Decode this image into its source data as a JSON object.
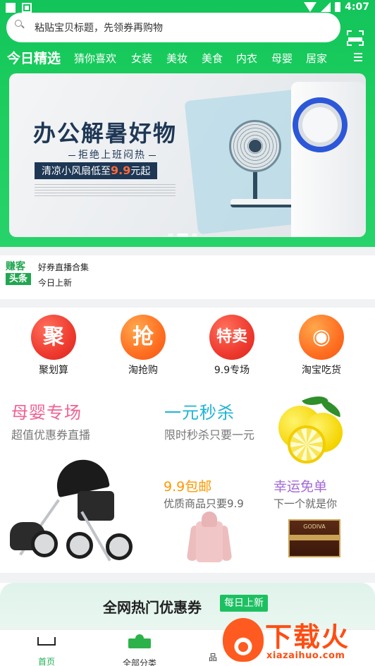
{
  "status_bar": {
    "time": "4:07"
  },
  "search": {
    "placeholder": "粘贴宝贝标题，先领券再购物",
    "scan_icon": "scan-icon"
  },
  "categories": [
    {
      "label": "今日精选",
      "active": true
    },
    {
      "label": "猜你喜欢"
    },
    {
      "label": "女装"
    },
    {
      "label": "美妆"
    },
    {
      "label": "美食"
    },
    {
      "label": "内衣"
    },
    {
      "label": "母婴"
    },
    {
      "label": "居家"
    }
  ],
  "banner": {
    "title": "办公解暑好物",
    "subtitle": "拒绝上班闷热",
    "tag_prefix": "清凉小风扇低至",
    "tag_price": "9.9",
    "tag_suffix": "元起",
    "slides": 3,
    "active_slide": 1
  },
  "news": {
    "logo_line1": "赚客",
    "logo_line2": "头条",
    "headline": "好券直播合集",
    "subline": "今日上新"
  },
  "quick_links": [
    {
      "label": "聚划算",
      "glyph": "聚",
      "color": "#ee3a2f"
    },
    {
      "label": "淘抢购",
      "glyph": "抢",
      "color": "#ff6f21"
    },
    {
      "label": "9.9专场",
      "glyph": "特卖",
      "color": "#ee3a2f"
    },
    {
      "label": "淘宝吃货",
      "glyph": "◉",
      "color": "#ff6f21"
    }
  ],
  "promos": {
    "baby": {
      "title": "母婴专场",
      "subtitle": "超值优惠券直播",
      "color": "#f06292"
    },
    "flash": {
      "title": "一元秒杀",
      "subtitle": "限时秒杀只要一元",
      "color": "#1eb3d6"
    },
    "free_ship": {
      "title": "9.9包邮",
      "subtitle": "优质商品只要9.9",
      "color": "#ff9800"
    },
    "lucky": {
      "title": "幸运免单",
      "subtitle": "下一个就是你",
      "color": "#a36ad6"
    }
  },
  "hot_section": {
    "title": "全网热门优惠券",
    "badge": "每日上新"
  },
  "tabbar": [
    {
      "label": "首页",
      "icon": "home-icon",
      "active": true
    },
    {
      "label": "全部分类",
      "icon": "category-icon"
    },
    {
      "label": "品",
      "icon": "brand-icon"
    }
  ],
  "watermark": {
    "name": "下载火",
    "url": "xiazaihuo.com"
  },
  "colors": {
    "brand_green": "#1ccd5e",
    "accent_red": "#ee3a2f"
  }
}
